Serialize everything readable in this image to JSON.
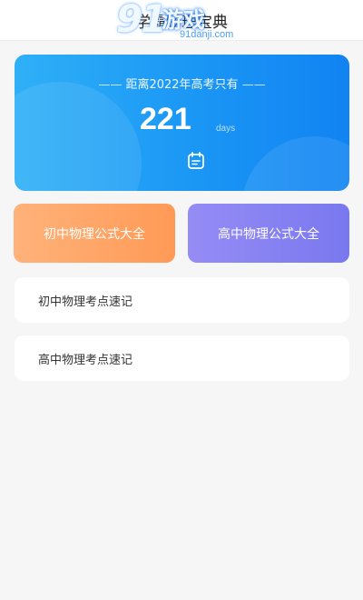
{
  "header": {
    "title": "学霸物理宝典",
    "watermark": {
      "number": "91",
      "text": "游戏",
      "domain": "91danji.com"
    }
  },
  "countdown": {
    "label": "距离2022年高考只有",
    "dash_left": "——",
    "dash_right": "——",
    "days": "221",
    "unit": "days",
    "icon": "calendar-icon"
  },
  "formula_buttons": [
    {
      "label": "初中物理公式大全",
      "color_from": "#ffb27a",
      "color_to": "#ff9a56"
    },
    {
      "label": "高中物理公式大全",
      "color_from": "#958cf5",
      "color_to": "#7a78ef"
    }
  ],
  "memo_cards": [
    {
      "label": "初中物理考点速记"
    },
    {
      "label": "高中物理考点速记"
    }
  ],
  "colors": {
    "background": "#f6f6f7",
    "card_blue": "#1a96f5",
    "text_dark": "#333333"
  }
}
